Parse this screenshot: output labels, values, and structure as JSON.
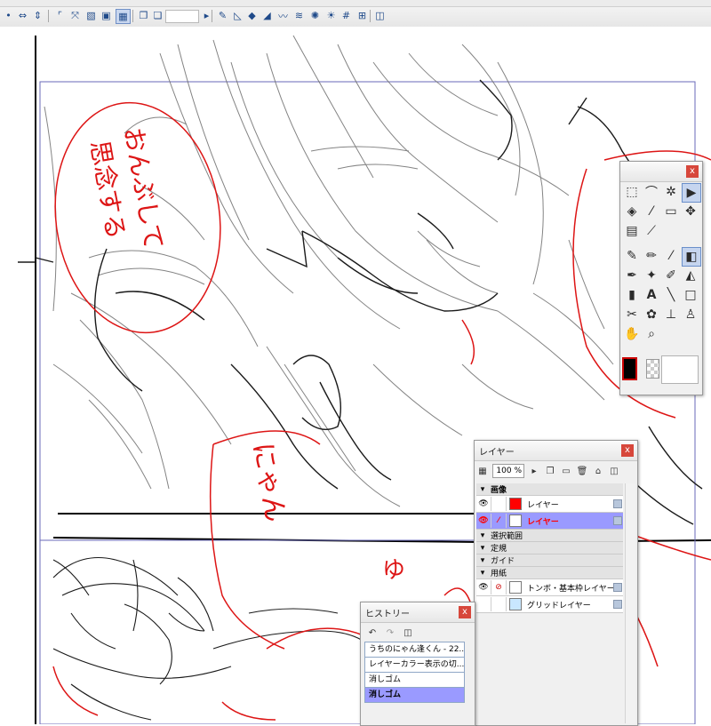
{
  "toolbar": {
    "icons": [
      "point-icon",
      "horizontal-arrows-icon",
      "vertical-arrows-icon",
      "corner-icon",
      "transform-icon",
      "mesh-icon",
      "save-icon",
      "grid-view-icon",
      "copy-icon",
      "paste-icon",
      "play-icon",
      "ruler-icon",
      "triangle-ruler-icon",
      "cube-icon",
      "perspective-icon",
      "curve-icon",
      "pattern-icon",
      "radial-icon",
      "grid-icon",
      "panel-toggle-icon"
    ]
  },
  "tool_panel": {
    "close": "x",
    "colors": {
      "main": "#000000",
      "accent": "#cc0000"
    }
  },
  "layer_panel": {
    "title": "レイヤー",
    "close": "x",
    "zoom": "100 %",
    "rows": [
      {
        "type": "folder",
        "label": "画像"
      },
      {
        "type": "layer",
        "label": "レイヤー",
        "active": false
      },
      {
        "type": "layer",
        "label": "レイヤー",
        "active": true
      },
      {
        "type": "folder",
        "label": "選択範囲"
      },
      {
        "type": "folder",
        "label": "定規"
      },
      {
        "type": "folder",
        "label": "ガイド"
      },
      {
        "type": "folder",
        "label": "用紙"
      },
      {
        "type": "layer",
        "label": "トンボ・基本枠レイヤー"
      },
      {
        "type": "layer",
        "label": "グリッドレイヤー"
      }
    ]
  },
  "history_panel": {
    "title": "ヒストリー",
    "close": "x",
    "items": [
      "うちのにゃん逢くん - 22...",
      "レイヤーカラー表示の切...",
      "消しゴム",
      "消しゴム"
    ],
    "active_index": 3
  },
  "canvas": {
    "annotations": [
      "おんぶして",
      "思念する",
      "にゃん",
      "ゆ"
    ]
  }
}
